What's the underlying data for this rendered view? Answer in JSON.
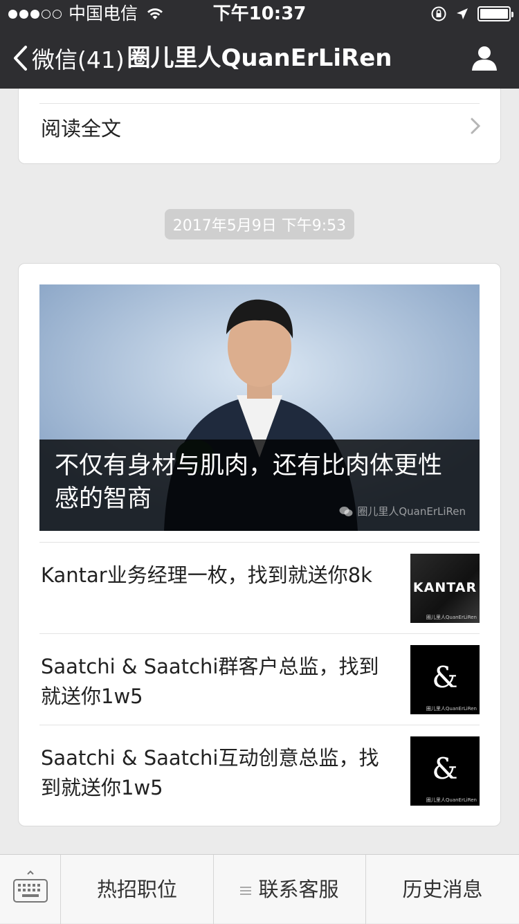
{
  "status_bar": {
    "carrier": "中国电信",
    "time": "下午10:37",
    "signal_bars_filled": 3,
    "signal_bars_total": 5,
    "battery_level": 1.0
  },
  "nav": {
    "back_label": "微信(41)",
    "title": "圈儿里人QuanErLiRen",
    "profile_icon": "person-icon"
  },
  "previous_card": {
    "read_more_label": "阅读全文"
  },
  "timestamp": "2017年5月9日 下午9:53",
  "main_card": {
    "cover_title": "不仅有身材与肌肉，还有比肉体更性感的智商",
    "cover_watermark": "圈儿里人QuanErLiRen",
    "articles": [
      {
        "title": "Kantar业务经理一枚，找到就送你8k",
        "thumb_text": "KANTAR",
        "thumb_watermark": "圈儿里人QuanErLiRen"
      },
      {
        "title": "Saatchi & Saatchi群客户总监，找到就送你1w5",
        "thumb_text": "&",
        "thumb_watermark": "圈儿里人QuanErLiRen"
      },
      {
        "title": "Saatchi & Saatchi互动创意总监，找到就送你1w5",
        "thumb_text": "&",
        "thumb_watermark": "圈儿里人QuanErLiRen"
      }
    ]
  },
  "bottom_menu": {
    "items": [
      {
        "label": "热招职位"
      },
      {
        "label": "联系客服"
      },
      {
        "label": "历史消息"
      }
    ]
  }
}
